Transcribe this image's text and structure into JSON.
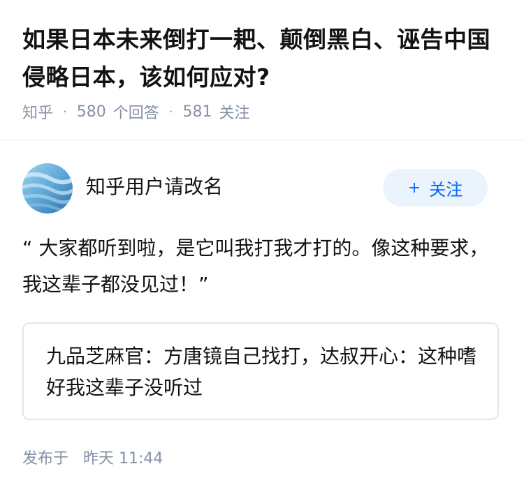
{
  "question": {
    "title": "如果日本未来倒打一耙、颠倒黑白、诬告中国侵略日本，该如何应对?",
    "meta": {
      "source": "知乎",
      "answers_count": "580",
      "answers_label": "个回答",
      "followers_count": "581",
      "followers_label": "关注"
    }
  },
  "author": {
    "name": "知乎用户请改名",
    "avatar_icon": "avatar-image",
    "follow_label": "关注",
    "follow_icon": "plus-icon"
  },
  "answer": {
    "text": "“ 大家都听到啦，是它叫我打我才打的。像这种要求，我这辈子都没见过！”",
    "quote": "九品芝麻官：方唐镜自己找打，达叔开心：这种嗜好我这辈子没听过"
  },
  "publish": {
    "label": "发布于",
    "time": "昨天 11:44"
  },
  "colors": {
    "meta_gray": "#8590a6",
    "follow_bg": "#ebf3fc",
    "follow_text": "#0066ff",
    "card_border": "#e4e6ea"
  }
}
